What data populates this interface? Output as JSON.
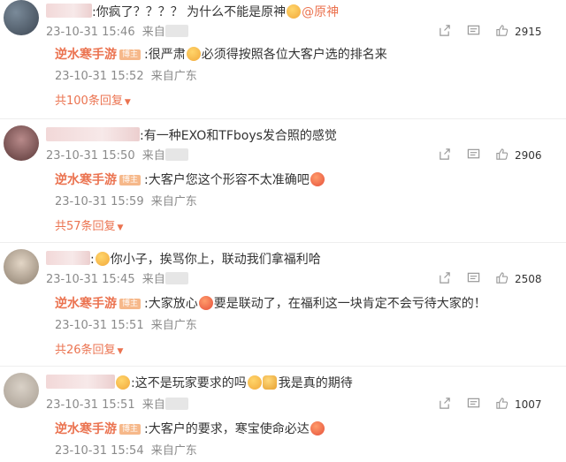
{
  "comments": [
    {
      "text_a": ":你疯了？？？？ 为什么不能是原神",
      "mention": "@原神",
      "time": "23-10-31 15:46",
      "loc_prefix": "来自",
      "likes": "2915",
      "reply": {
        "name": "逆水寒手游",
        "badge": "博主",
        "text_a": ":很严肃",
        "text_b": "必须得按照各位大客户选的排名来",
        "time": "23-10-31 15:52",
        "loc": "来自广东"
      },
      "more": "共100条回复"
    },
    {
      "text_a": ":有一种EXO和TFboys发合照的感觉",
      "time": "23-10-31 15:50",
      "loc_prefix": "来自",
      "likes": "2906",
      "reply": {
        "name": "逆水寒手游",
        "badge": "博主",
        "text_a": ":大客户您这个形容不太准确吧",
        "time": "23-10-31 15:59",
        "loc": "来自广东"
      },
      "more": "共57条回复"
    },
    {
      "text_a": ":",
      "text_b": "你小子，挨骂你上，联动我们拿福利哈",
      "time": "23-10-31 15:45",
      "loc_prefix": "来自",
      "likes": "2508",
      "reply": {
        "name": "逆水寒手游",
        "badge": "博主",
        "text_a": ":大家放心",
        "text_b": "要是联动了，在福利这一块肯定不会亏待大家的！",
        "time": "23-10-31 15:51",
        "loc": "来自广东"
      },
      "more": "共26条回复"
    },
    {
      "text_a": ":这不是玩家要求的吗",
      "text_b": "我是真的期待",
      "time": "23-10-31 15:51",
      "loc_prefix": "来自",
      "likes": "1007",
      "reply": {
        "name": "逆水寒手游",
        "badge": "博主",
        "text_a": ":大客户的要求，寒宝使命必达",
        "time": "23-10-31 15:54",
        "loc": "来自广东"
      }
    }
  ],
  "icons": [
    "share-icon",
    "comment-icon",
    "like-icon",
    "emoji-icon"
  ],
  "colors": {
    "accent": "#eb7350",
    "meta": "#8a8a8a",
    "badge": "#f6b88a"
  }
}
